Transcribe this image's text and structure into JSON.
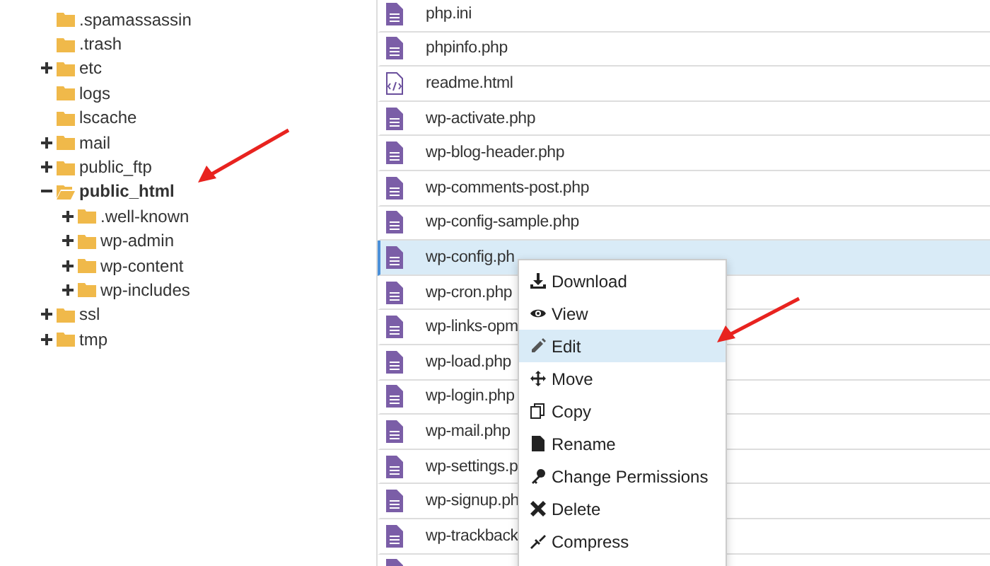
{
  "tree": [
    {
      "name": ".spamassassin",
      "selected": false
    },
    {
      "name": ".trash",
      "selected": false
    },
    {
      "name": "etc",
      "selected": false,
      "expanded": false
    },
    {
      "name": "logs",
      "selected": false
    },
    {
      "name": "lscache",
      "selected": false
    },
    {
      "name": "mail",
      "selected": false,
      "expanded": false
    },
    {
      "name": "public_ftp",
      "selected": false,
      "expanded": false
    },
    {
      "name": "public_html",
      "selected": true,
      "expanded": true,
      "children": [
        {
          "name": ".well-known",
          "selected": false,
          "expanded": false
        },
        {
          "name": "wp-admin",
          "selected": false,
          "expanded": false
        },
        {
          "name": "wp-content",
          "selected": false,
          "expanded": false
        },
        {
          "name": "wp-includes",
          "selected": false,
          "expanded": false
        }
      ]
    },
    {
      "name": "ssl",
      "selected": false,
      "expanded": false
    },
    {
      "name": "tmp",
      "selected": false,
      "expanded": false
    }
  ],
  "files": [
    {
      "name": "php.ini",
      "kind": "text",
      "selected": false
    },
    {
      "name": "phpinfo.php",
      "kind": "text",
      "selected": false
    },
    {
      "name": "readme.html",
      "kind": "code",
      "selected": false
    },
    {
      "name": "wp-activate.php",
      "kind": "text",
      "selected": false
    },
    {
      "name": "wp-blog-header.php",
      "kind": "text",
      "selected": false
    },
    {
      "name": "wp-comments-post.php",
      "kind": "text",
      "selected": false
    },
    {
      "name": "wp-config-sample.php",
      "kind": "text",
      "selected": false
    },
    {
      "name": "wp-config.ph",
      "kind": "text",
      "selected": true
    },
    {
      "name": "wp-cron.php",
      "kind": "text",
      "selected": false
    },
    {
      "name": "wp-links-opm",
      "kind": "text",
      "selected": false
    },
    {
      "name": "wp-load.php",
      "kind": "text",
      "selected": false
    },
    {
      "name": "wp-login.php",
      "kind": "text",
      "selected": false
    },
    {
      "name": "wp-mail.php",
      "kind": "text",
      "selected": false
    },
    {
      "name": "wp-settings.p",
      "kind": "text",
      "selected": false
    },
    {
      "name": "wp-signup.ph",
      "kind": "text",
      "selected": false
    },
    {
      "name": "wp-trackback",
      "kind": "text",
      "selected": false
    },
    {
      "kind": "text",
      "selected": false
    }
  ],
  "context_menu": [
    {
      "label": "Download",
      "selected": false
    },
    {
      "label": "View",
      "selected": false
    },
    {
      "label": "Edit",
      "selected": true
    },
    {
      "label": "Move",
      "selected": false
    },
    {
      "label": "Copy",
      "selected": false
    },
    {
      "label": "Rename",
      "selected": false
    },
    {
      "label": "Change Permissions",
      "selected": false
    },
    {
      "label": "Delete",
      "selected": false
    },
    {
      "label": "Compress",
      "selected": false
    }
  ]
}
